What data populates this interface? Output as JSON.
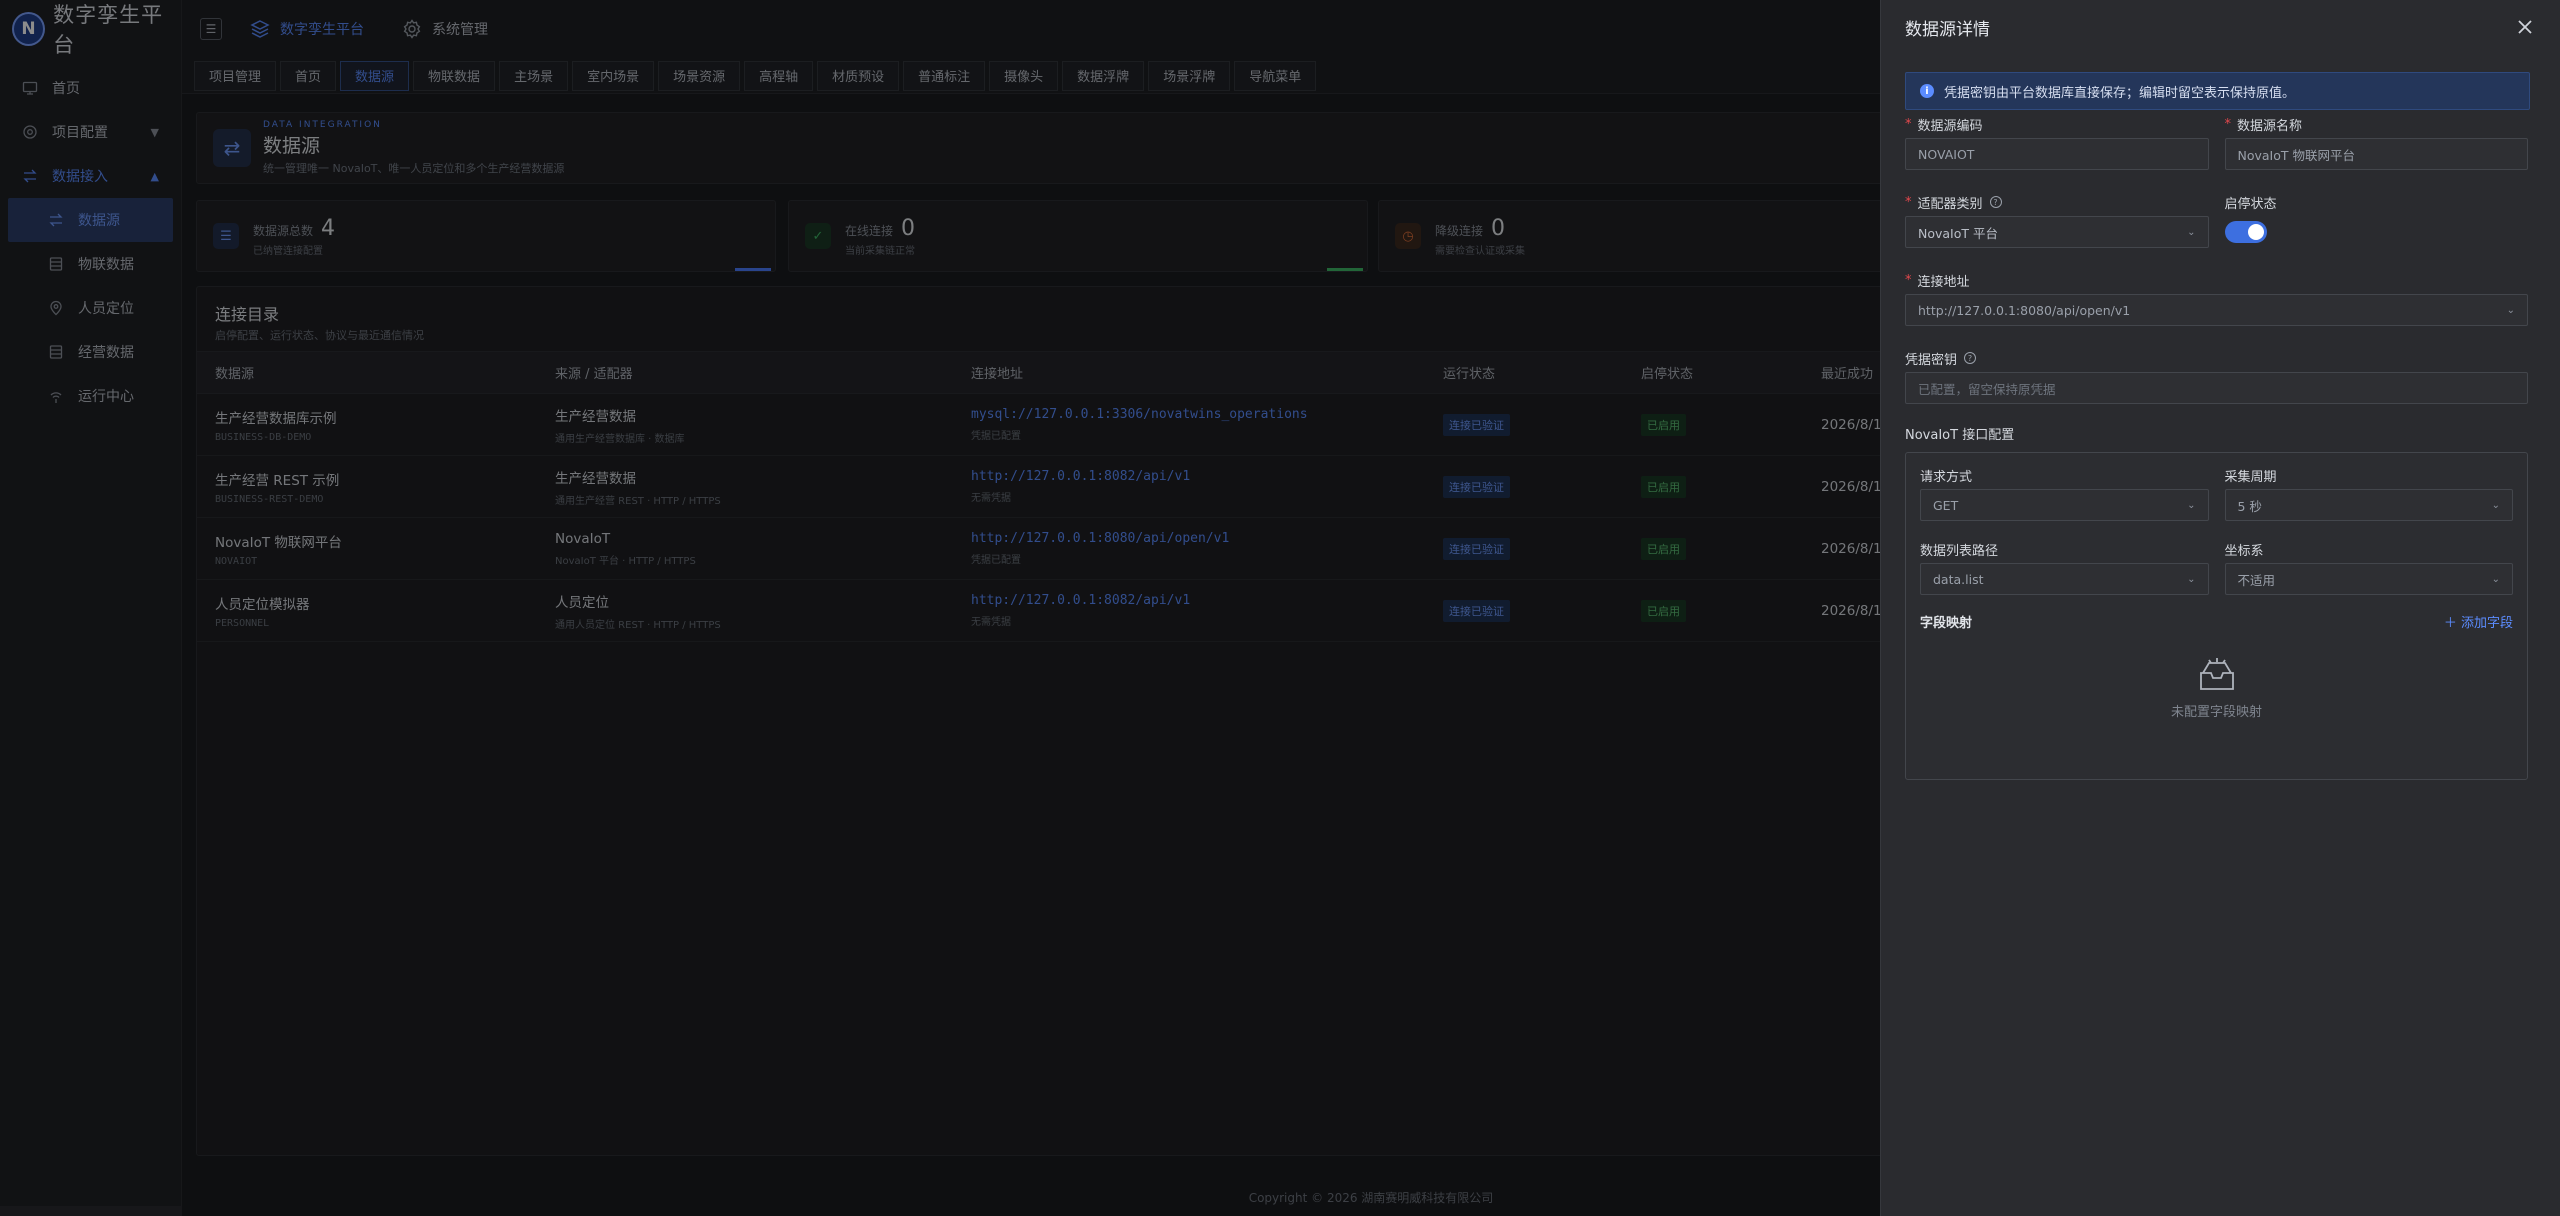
{
  "brand": {
    "logo_letter": "N",
    "title": "数字孪生平台"
  },
  "sidebar": {
    "items": [
      {
        "label": "首页",
        "icon": "monitor-icon"
      },
      {
        "label": "项目配置",
        "icon": "gear-icon"
      },
      {
        "label": "数据接入",
        "icon": "swap-icon"
      }
    ],
    "sub_items": [
      {
        "label": "数据源",
        "icon": "swap-icon"
      },
      {
        "label": "物联数据",
        "icon": "database-icon"
      },
      {
        "label": "人员定位",
        "icon": "location-icon"
      },
      {
        "label": "经营数据",
        "icon": "database-icon"
      },
      {
        "label": "运行中心",
        "icon": "signal-icon"
      }
    ]
  },
  "topbar": {
    "menus": [
      {
        "label": "数字孪生平台"
      },
      {
        "label": "系统管理"
      }
    ]
  },
  "tabs": [
    "项目管理",
    "首页",
    "数据源",
    "物联数据",
    "主场景",
    "室内场景",
    "场景资源",
    "高程轴",
    "材质预设",
    "普通标注",
    "摄像头",
    "数据浮牌",
    "场景浮牌",
    "导航菜单"
  ],
  "header": {
    "eyebrow": "DATA INTEGRATION",
    "title": "数据源",
    "subtitle": "统一管理唯一 NovaIoT、唯一人员定位和多个生产经营数据源"
  },
  "stats": [
    {
      "label": "数据源总数",
      "value": "4",
      "sub": "已纳管连接配置",
      "color": "#4c7dff"
    },
    {
      "label": "在线连接",
      "value": "0",
      "sub": "当前采集链正常",
      "color": "#3fb867"
    },
    {
      "label": "降级连接",
      "value": "0",
      "sub": "需要检查认证或采集",
      "color": "#e0703a"
    }
  ],
  "table": {
    "title": "连接目录",
    "subtitle": "启停配置、运行状态、协议与最近通信情况",
    "columns": [
      "数据源",
      "来源 / 适配器",
      "连接地址",
      "运行状态",
      "启停状态",
      "最近成功"
    ],
    "rows": [
      {
        "name": "生产经营数据库示例",
        "code": "BUSINESS-DB-DEMO",
        "source": "生产经营数据",
        "adapter": "通用生产经营数据库 · 数据库",
        "url": "mysql://127.0.0.1:3306/novatwins_operations",
        "cred": "凭据已配置",
        "run": "连接已验证",
        "enable": "已启用",
        "last": "2026/8/1"
      },
      {
        "name": "生产经营 REST 示例",
        "code": "BUSINESS-REST-DEMO",
        "source": "生产经营数据",
        "adapter": "通用生产经营 REST · HTTP / HTTPS",
        "url": "http://127.0.0.1:8082/api/v1",
        "cred": "无需凭据",
        "run": "连接已验证",
        "enable": "已启用",
        "last": "2026/8/1"
      },
      {
        "name": "NovaIoT 物联网平台",
        "code": "NOVAIOT",
        "source": "NovaIoT",
        "adapter": "NovaIoT 平台 · HTTP / HTTPS",
        "url": "http://127.0.0.1:8080/api/open/v1",
        "cred": "凭据已配置",
        "run": "连接已验证",
        "enable": "已启用",
        "last": "2026/8/1"
      },
      {
        "name": "人员定位模拟器",
        "code": "PERSONNEL",
        "source": "人员定位",
        "adapter": "通用人员定位 REST · HTTP / HTTPS",
        "url": "http://127.0.0.1:8082/api/v1",
        "cred": "无需凭据",
        "run": "连接已验证",
        "enable": "已启用",
        "last": "2026/8/1"
      }
    ]
  },
  "footer": "Copyright © 2026 湖南赛明威科技有限公司",
  "drawer": {
    "title": "数据源详情",
    "info": "凭据密钥由平台数据库直接保存；编辑时留空表示保持原值。",
    "code_label": "数据源编码",
    "code_value": "NOVAIOT",
    "name_label": "数据源名称",
    "name_value": "NovaIoT 物联网平台",
    "adapter_label": "适配器类别",
    "adapter_value": "NovaIoT 平台",
    "status_label": "启停状态",
    "url_label": "连接地址",
    "url_value": "http://127.0.0.1:8080/api/open/v1",
    "secret_label": "凭据密钥",
    "secret_placeholder": "已配置，留空保持原凭据",
    "api_section": "NovaIoT 接口配置",
    "method_label": "请求方式",
    "method_value": "GET",
    "period_label": "采集周期",
    "period_value": "5 秒",
    "path_label": "数据列表路径",
    "path_value": "data.list",
    "coord_label": "坐标系",
    "coord_value": "不适用",
    "mapping_title": "字段映射",
    "mapping_add": "添加字段",
    "mapping_empty": "未配置字段映射"
  }
}
